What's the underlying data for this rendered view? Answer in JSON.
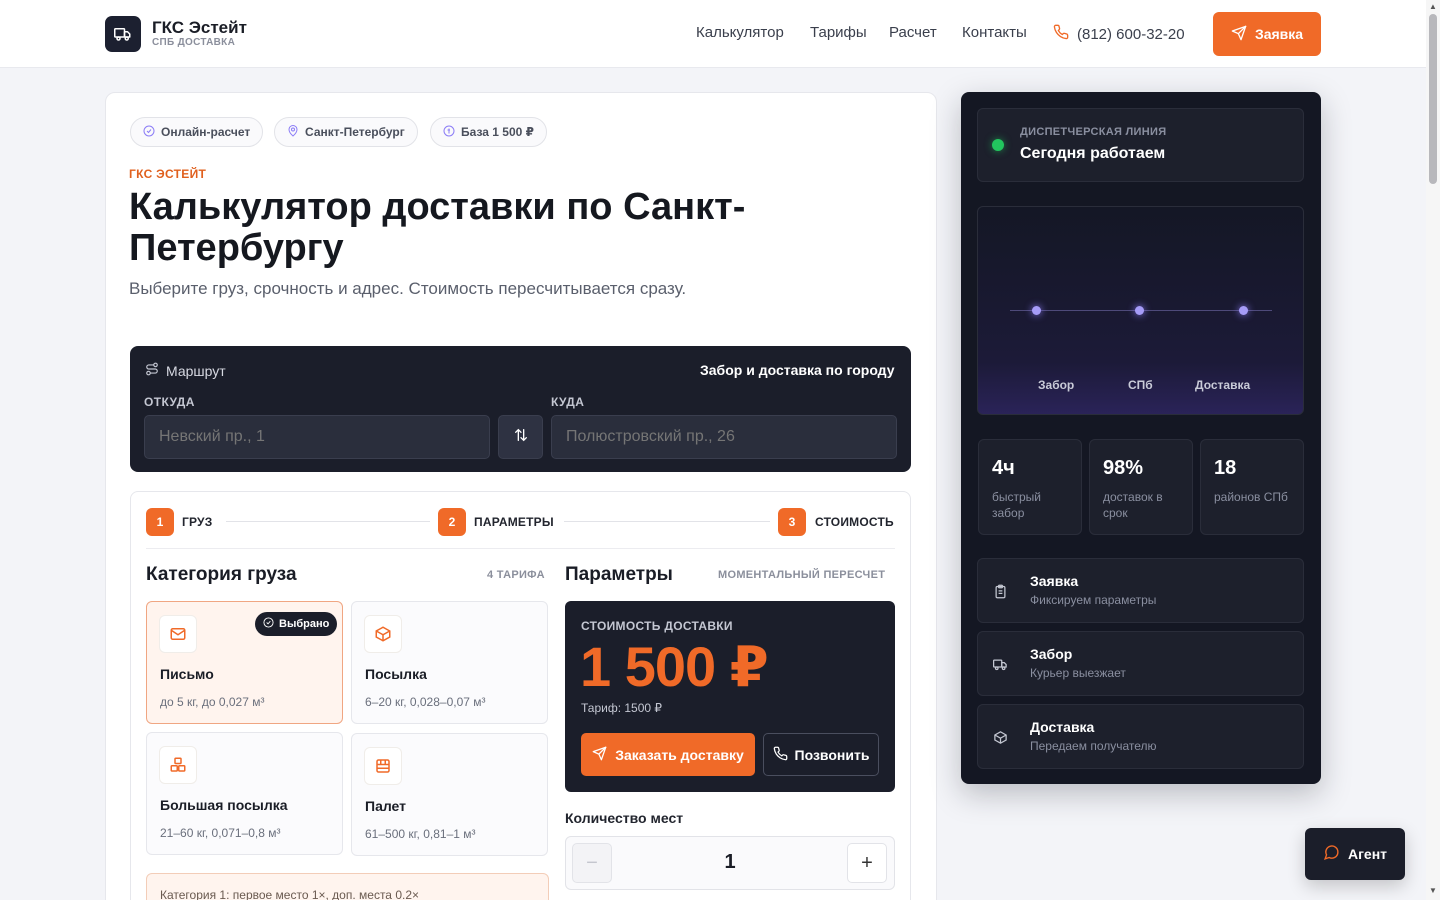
{
  "header": {
    "brand": "ГКС Эстейт",
    "brand_sub": "СПБ ДОСТАВКА",
    "nav": [
      "Калькулятор",
      "Тарифы",
      "Расчет",
      "Контакты"
    ],
    "phone": "(812) 600-32-20",
    "cta": "Заявка"
  },
  "hero": {
    "chips": [
      "Онлайн-расчет",
      "Санкт-Петербург",
      "База 1 500 ₽"
    ],
    "eyebrow": "ГКС ЭСТЕЙТ",
    "title": "Калькулятор доставки по Санкт-Петербургу",
    "lead": "Выберите груз, срочность и адрес. Стоимость пересчитывается сразу."
  },
  "route": {
    "title": "Маршрут",
    "right": "Забор и доставка по городу",
    "from_label": "ОТКУДА",
    "from_placeholder": "Невский пр., 1",
    "to_label": "КУДА",
    "to_placeholder": "Полюстровский пр., 26"
  },
  "steps": [
    {
      "num": "1",
      "label": "ГРУЗ"
    },
    {
      "num": "2",
      "label": "ПАРАМЕТРЫ"
    },
    {
      "num": "3",
      "label": "СТОИМОСТЬ"
    }
  ],
  "category": {
    "title": "Категория груза",
    "meta": "4 ТАРИФА",
    "selected_badge": "Выбрано",
    "items": [
      {
        "name": "Письмо",
        "desc": "до 5 кг, до 0,027 м³",
        "icon": "mail-icon",
        "selected": true
      },
      {
        "name": "Посылка",
        "desc": "6–20 кг, 0,028–0,07 м³",
        "icon": "box-icon",
        "selected": false
      },
      {
        "name": "Большая посылка",
        "desc": "21–60 кг, 0,071–0,8 м³",
        "icon": "boxes-icon",
        "selected": false
      },
      {
        "name": "Палет",
        "desc": "61–500 кг, 0,81–1 м³",
        "icon": "pallet-icon",
        "selected": false
      }
    ],
    "hint": "Категория 1: первое место 1×, доп. места 0.2×"
  },
  "params": {
    "title": "Параметры",
    "meta": "МОМЕНТАЛЬНЫЙ ПЕРЕСЧЕТ",
    "price_label": "СТОИМОСТЬ ДОСТАВКИ",
    "price": "1 500 ₽",
    "tariff": "Тариф: 1500 ₽",
    "order_btn": "Заказать доставку",
    "call_btn": "Позвонить",
    "qty_label": "Количество мест",
    "qty_value": "1",
    "minus": "−",
    "plus": "+"
  },
  "side": {
    "dispatch_label": "ДИСПЕТЧЕРСКАЯ ЛИНИЯ",
    "dispatch_title": "Сегодня работаем",
    "route_points": [
      "Забор",
      "СПб",
      "Доставка"
    ],
    "stats": [
      {
        "value": "4ч",
        "label": "быстрый забор"
      },
      {
        "value": "98%",
        "label": "доставок в срок"
      },
      {
        "value": "18",
        "label": "районов СПб"
      }
    ],
    "flow": [
      {
        "title": "Заявка",
        "desc": "Фиксируем параметры",
        "icon": "clipboard-icon"
      },
      {
        "title": "Забор",
        "desc": "Курьер выезжает",
        "icon": "truck-icon"
      },
      {
        "title": "Доставка",
        "desc": "Передаем получателю",
        "icon": "package-icon"
      }
    ]
  },
  "agent": {
    "label": "Агент"
  },
  "colors": {
    "accent": "#f06a28",
    "dark": "#1b1e2a",
    "status_online": "#22c55e"
  }
}
